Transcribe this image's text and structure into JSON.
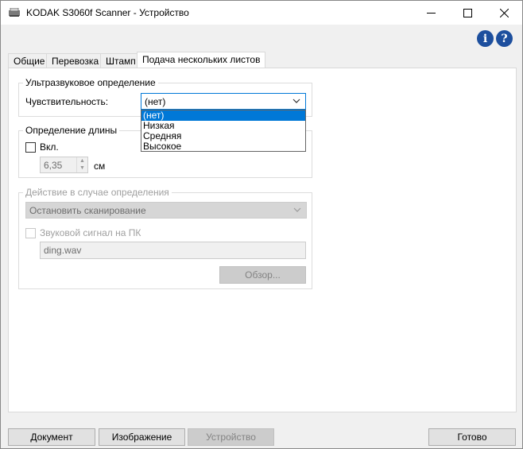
{
  "window": {
    "title": "KODAK S3060f Scanner - Устройство",
    "icon": "scanner-icon"
  },
  "title_buttons": {
    "minimize": "─",
    "maximize": "☐",
    "close": "✕"
  },
  "help": {
    "info_glyph": "i",
    "help_glyph": "?"
  },
  "tabs": [
    {
      "label": "Общие"
    },
    {
      "label": "Перевозка"
    },
    {
      "label": "Штамп"
    },
    {
      "label": "Подача нескольких листов"
    }
  ],
  "ultrasonic": {
    "title": "Ультразвуковое определение",
    "sensitivity_label": "Чувствительность:",
    "sensitivity_value": "(нет)",
    "options": [
      "(нет)",
      "Низкая",
      "Средняя",
      "Высокое"
    ]
  },
  "length": {
    "title": "Определение длины",
    "enable_label": "Вкл.",
    "value": "6,35",
    "unit": "см"
  },
  "action": {
    "title": "Действие в случае определения",
    "action_value": "Остановить сканирование",
    "sound_label": "Звуковой сигнал на ПК",
    "sound_file": "ding.wav",
    "browse_label": "Обзор..."
  },
  "footer": {
    "document": "Документ",
    "image": "Изображение",
    "device": "Устройство",
    "done": "Готово"
  }
}
